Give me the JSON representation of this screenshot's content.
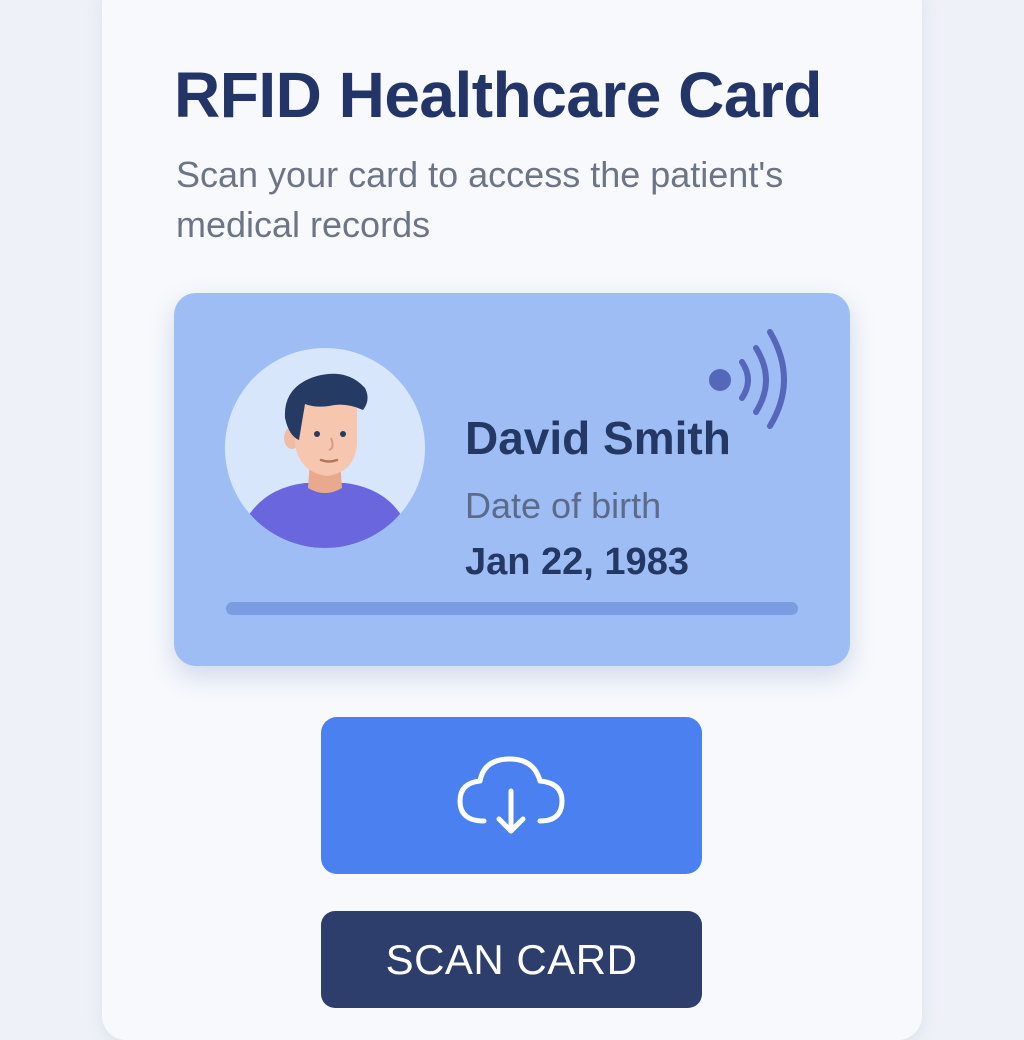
{
  "header": {
    "title": "RFID Healthcare Card",
    "subtitle": "Scan your card to access the patient's medical records"
  },
  "card": {
    "holder_name": "David Smith",
    "dob_label": "Date of birth",
    "dob_value": "Jan 22, 1983",
    "avatar_icon": "person-avatar",
    "signal_icon": "rfid-signal-icon"
  },
  "actions": {
    "download_icon": "cloud-download-icon",
    "scan_label": "SCAN CARD"
  },
  "colors": {
    "title": "#233566",
    "card_background": "#9fbdf5",
    "download_button": "#4a80ef",
    "scan_button": "#2d3e6c"
  }
}
